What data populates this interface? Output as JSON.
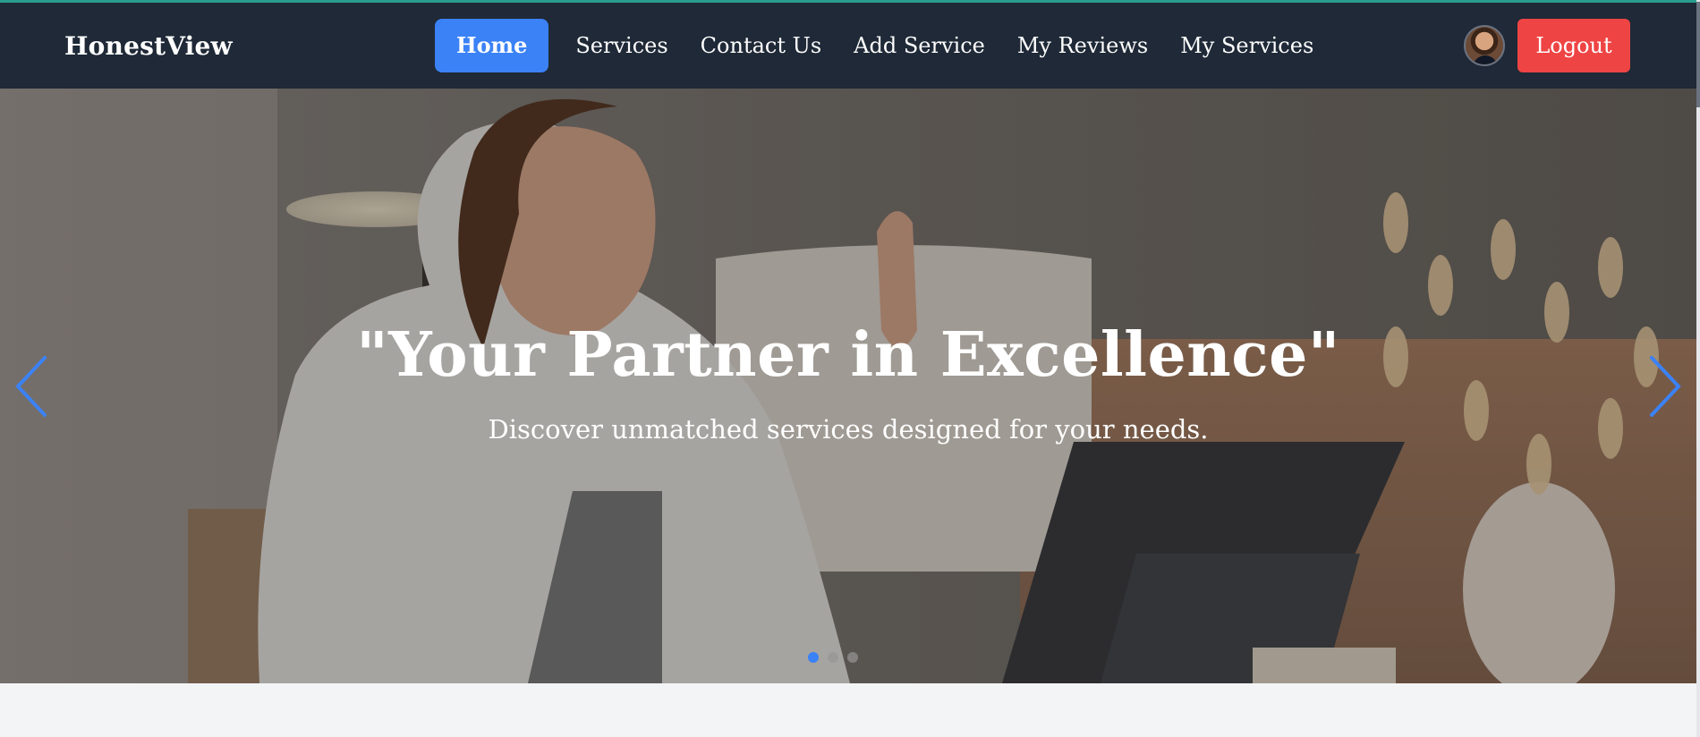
{
  "brand": {
    "name": "HonestView"
  },
  "nav": {
    "items": [
      {
        "label": "Home",
        "active": true
      },
      {
        "label": "Services",
        "active": false
      },
      {
        "label": "Contact Us",
        "active": false
      },
      {
        "label": "Add Service",
        "active": false
      },
      {
        "label": "My Reviews",
        "active": false
      },
      {
        "label": "My Services",
        "active": false
      }
    ],
    "logout_label": "Logout"
  },
  "hero": {
    "title": "\"Your Partner in Excellence\"",
    "subtitle": "Discover unmatched services designed for your needs.",
    "slide_count": 3,
    "active_slide": 1
  },
  "colors": {
    "navbar": "#1f2937",
    "active_nav": "#3b82f6",
    "logout": "#ef4444",
    "arrow": "#3b82f6",
    "page_bg": "#f3f4f6"
  },
  "icons": {
    "prev": "chevron-left-icon",
    "next": "chevron-right-icon"
  }
}
